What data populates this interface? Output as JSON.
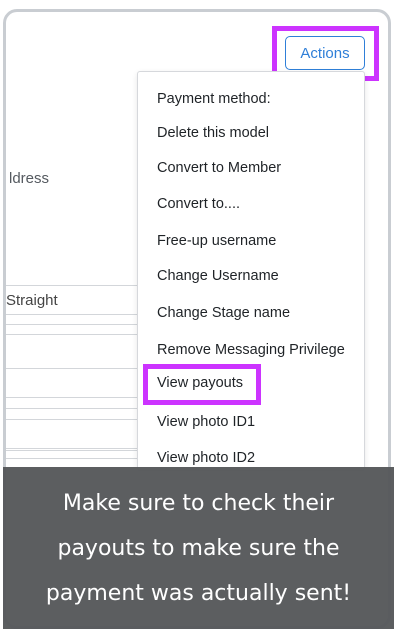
{
  "background_form": {
    "address_label_fragment": "ldress",
    "orientation_value_fragment": "Straight"
  },
  "actions_button": {
    "label": "Actions"
  },
  "actions_menu": {
    "items": [
      "Payment method:",
      "Delete this model",
      "Convert to Member",
      "Convert to....",
      "Free-up username",
      "Change Username",
      "Change Stage name",
      "Remove Messaging Privilege",
      "View payouts",
      "View photo ID1",
      "View photo ID2"
    ],
    "highlighted_item": "View payouts"
  },
  "caption": {
    "lines": [
      "Make sure to check their",
      "payouts to make sure the",
      "payment was actually sent!"
    ]
  },
  "colors": {
    "highlight": "#cc33ff",
    "button_accent": "#2f7fd8",
    "caption_background": "#55575a"
  }
}
